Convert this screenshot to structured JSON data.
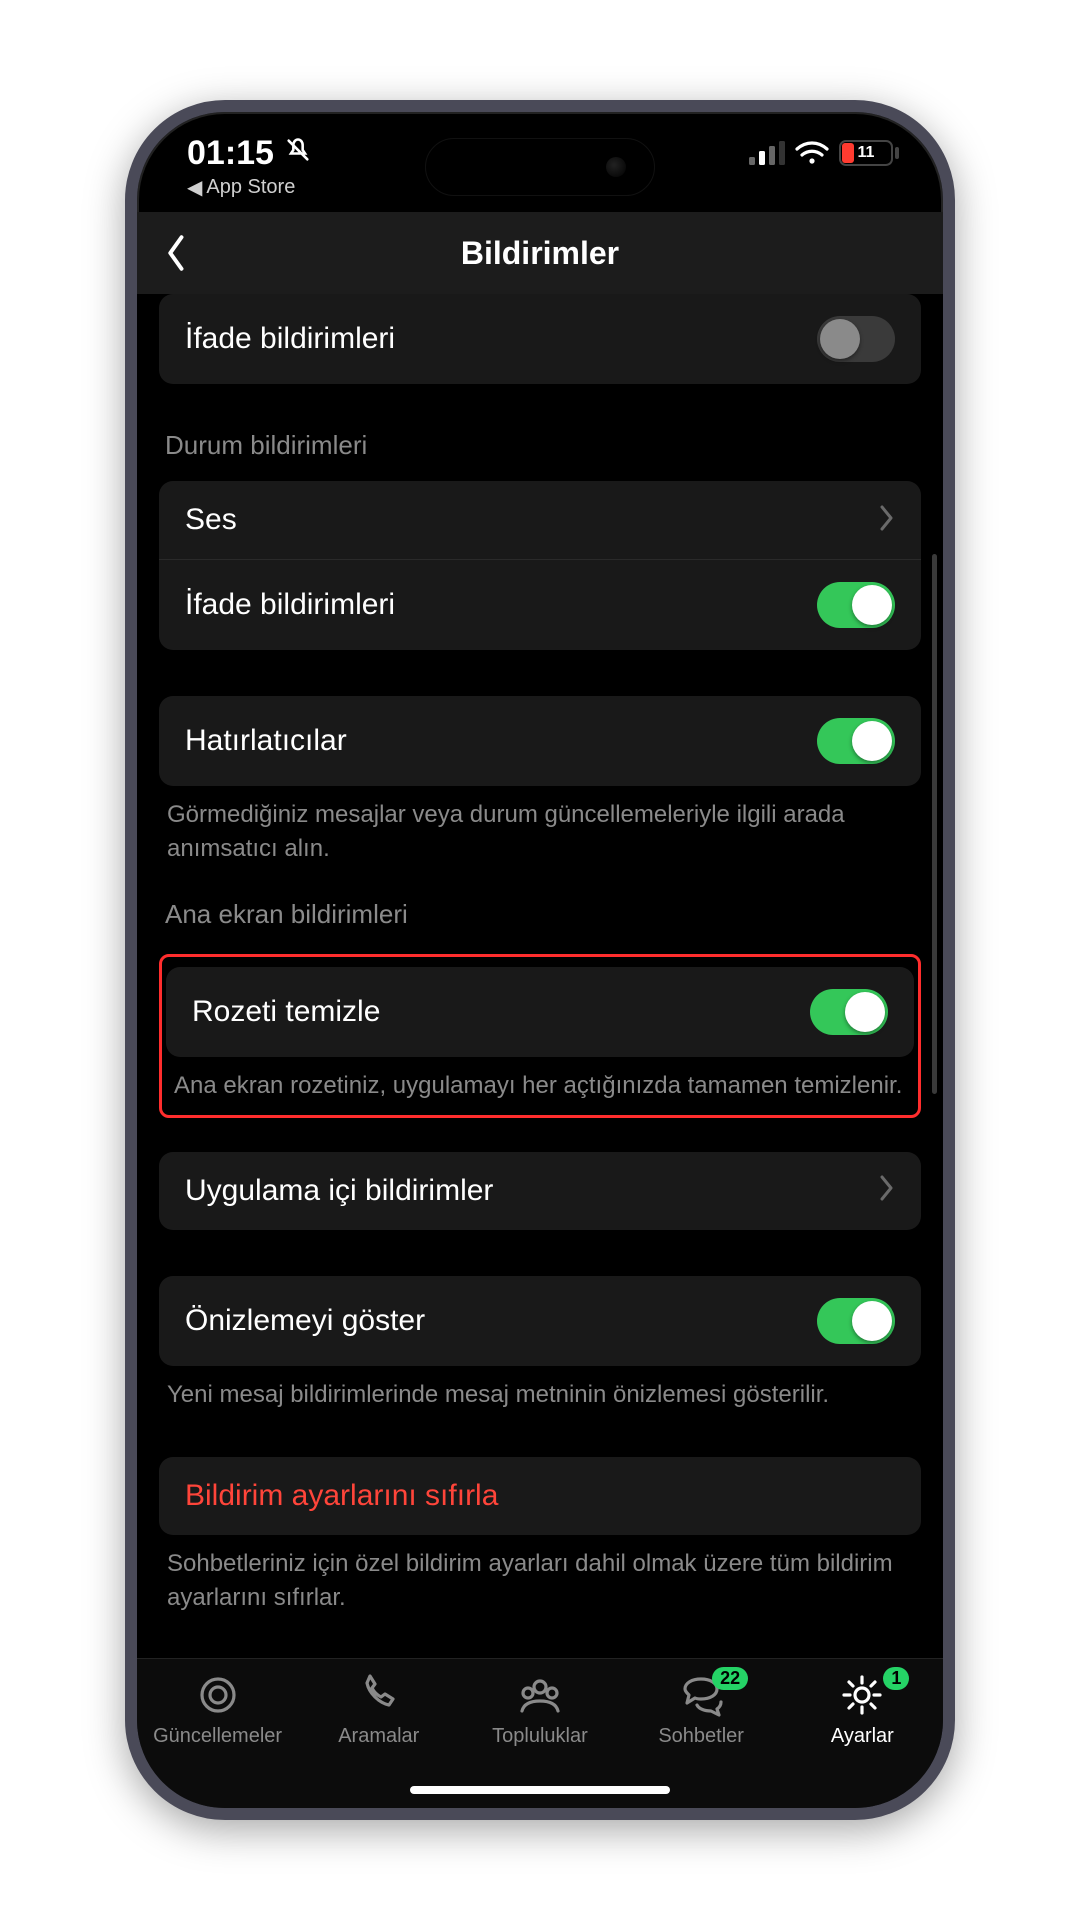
{
  "status": {
    "time": "01:15",
    "back_app_label": "App Store",
    "battery_percent": "11"
  },
  "nav": {
    "title": "Bildirimler"
  },
  "rows": {
    "ifade_top": "İfade bildirimleri",
    "durum_header": "Durum bildirimleri",
    "ses": "Ses",
    "ifade2": "İfade bildirimleri",
    "hatirlat": "Hatırlatıcılar",
    "hatirlat_footer": "Görmediğiniz mesajlar veya durum güncellemeleriyle ilgili arada anımsatıcı alın.",
    "ana_header": "Ana ekran bildirimleri",
    "rozet": "Rozeti temizle",
    "rozet_footer": "Ana ekran rozetiniz, uygulamayı her açtığınızda tamamen temizlenir.",
    "uygulama_ici": "Uygulama içi bildirimler",
    "onizleme": "Önizlemeyi göster",
    "onizleme_footer": "Yeni mesaj bildirimlerinde mesaj metninin önizlemesi gösterilir.",
    "reset": "Bildirim ayarlarını sıfırla",
    "reset_footer": "Sohbetleriniz için özel bildirim ayarları dahil olmak üzere tüm bildirim ayarlarını sıfırlar."
  },
  "tabs": {
    "updates": "Güncellemeler",
    "calls": "Aramalar",
    "communities": "Topluluklar",
    "chats": "Sohbetler",
    "chats_badge": "22",
    "settings": "Ayarlar",
    "settings_badge": "1"
  }
}
